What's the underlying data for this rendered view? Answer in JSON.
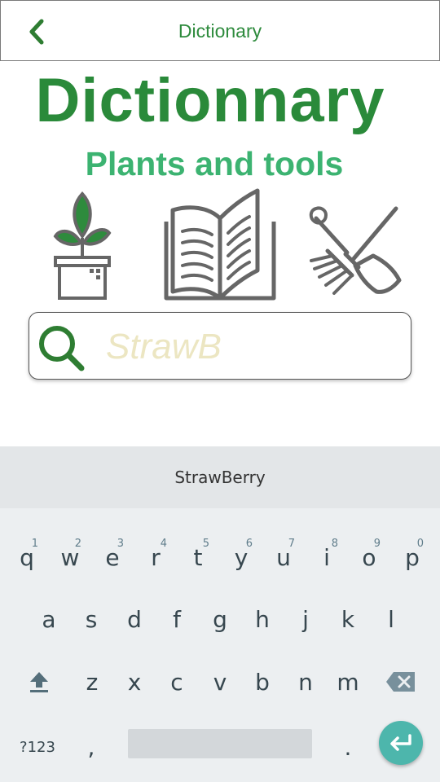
{
  "header": {
    "title": "Dictionary",
    "back_icon": "chevron-left-icon"
  },
  "hero": {
    "title": "Dictionnary",
    "subtitle": "Plants and tools"
  },
  "search": {
    "value": "StrawB",
    "icon": "search-icon"
  },
  "keyboard": {
    "suggestion": "StrawBerry",
    "row1": [
      {
        "key": "q",
        "hint": "1"
      },
      {
        "key": "w",
        "hint": "2"
      },
      {
        "key": "e",
        "hint": "3"
      },
      {
        "key": "r",
        "hint": "4"
      },
      {
        "key": "t",
        "hint": "5"
      },
      {
        "key": "y",
        "hint": "6"
      },
      {
        "key": "u",
        "hint": "7"
      },
      {
        "key": "i",
        "hint": "8"
      },
      {
        "key": "o",
        "hint": "9"
      },
      {
        "key": "p",
        "hint": "0"
      }
    ],
    "row2": [
      "a",
      "s",
      "d",
      "f",
      "g",
      "h",
      "j",
      "k",
      "l"
    ],
    "row3": [
      "z",
      "x",
      "c",
      "v",
      "b",
      "n",
      "m"
    ],
    "symbols_label": "?123",
    "comma": ",",
    "period": "."
  },
  "colors": {
    "primary_green": "#2a8a3a",
    "light_green": "#3cb371",
    "enter_teal": "#4db6ac"
  }
}
